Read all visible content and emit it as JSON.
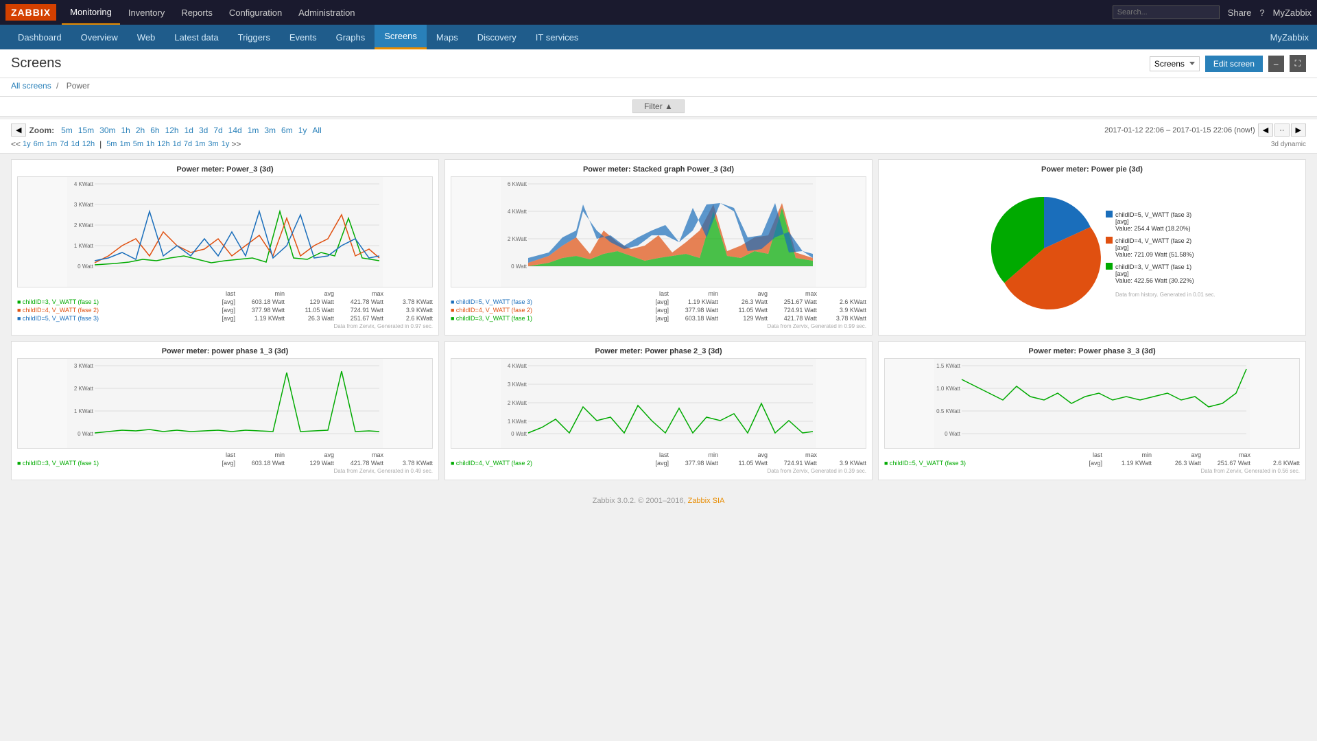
{
  "app": {
    "logo": "ZABBIX"
  },
  "top_nav": {
    "items": [
      {
        "label": "Monitoring",
        "active": true
      },
      {
        "label": "Inventory",
        "active": false
      },
      {
        "label": "Reports",
        "active": false
      },
      {
        "label": "Configuration",
        "active": false
      },
      {
        "label": "Administration",
        "active": false
      }
    ],
    "right": {
      "search_placeholder": "Search...",
      "share": "Share",
      "help": "?",
      "user": "MyZabbix"
    }
  },
  "sub_nav": {
    "items": [
      {
        "label": "Dashboard"
      },
      {
        "label": "Overview"
      },
      {
        "label": "Web"
      },
      {
        "label": "Latest data"
      },
      {
        "label": "Triggers"
      },
      {
        "label": "Events"
      },
      {
        "label": "Graphs"
      },
      {
        "label": "Screens",
        "active": true
      },
      {
        "label": "Maps"
      },
      {
        "label": "Discovery"
      },
      {
        "label": "IT services"
      }
    ],
    "right": "MyZabbix"
  },
  "page": {
    "title": "Screens",
    "breadcrumb_home": "All screens",
    "breadcrumb_separator": "/",
    "breadcrumb_current": "Power",
    "screens_dropdown": "Screens",
    "edit_button": "Edit screen",
    "filter_label": "Filter ▲"
  },
  "zoom": {
    "label": "Zoom:",
    "options": [
      "5m",
      "15m",
      "30m",
      "1h",
      "2h",
      "6h",
      "12h",
      "1d",
      "3d",
      "7d",
      "14d",
      "1m",
      "3m",
      "6m",
      "1y",
      "All"
    ],
    "date_range": "2017-01-12 22:06 – 2017-01-15 22:06 (now!)",
    "time_nav": [
      "<<",
      "1y",
      "6m",
      "1m",
      "7d",
      "1d",
      "12h",
      "5m",
      "1m",
      "5m",
      "1h",
      "12h",
      "1d",
      "7d",
      "1m",
      "3m",
      "1y",
      ">>"
    ],
    "period_label": "3d dynamic"
  },
  "charts": {
    "row1": [
      {
        "title": "Power meter: Power_3 (3d)",
        "y_labels": [
          "4 KWatt",
          "3 KWatt",
          "2 KWatt",
          "1 KWatt",
          "0 Watt"
        ],
        "series": [
          {
            "label": "childID=3, V_WATT (fase 1)",
            "color": "#00aa00",
            "last": "603.18 Watt",
            "min": "129 Watt",
            "avg": "421.78 Watt",
            "max": "3.78 KWatt"
          },
          {
            "label": "childID=4, V_WATT (fase 2)",
            "color": "#e05010",
            "last": "377.98 Watt",
            "min": "11.05 Watt",
            "avg": "724.91 Watt",
            "max": "3.9 KWatt"
          },
          {
            "label": "childID=5, V_WATT (fase 3)",
            "color": "#1a6ebb",
            "last": "1.19 KWatt",
            "min": "26.3 Watt",
            "avg": "251.67 Watt",
            "max": "2.6 KWatt"
          }
        ]
      },
      {
        "title": "Power meter: Stacked graph Power_3 (3d)",
        "y_labels": [
          "6 KWatt",
          "4 KWatt",
          "2 KWatt",
          "0 Watt"
        ],
        "series": [
          {
            "label": "childID=5, V_WATT (fase 3)",
            "color": "#1a6ebb",
            "last": "1.19 KWatt",
            "min": "26.3 Watt",
            "avg": "251.67 Watt",
            "max": "2.6 KWatt"
          },
          {
            "label": "childID=4, V_WATT (fase 2)",
            "color": "#e05010",
            "last": "377.98 Watt",
            "min": "11.05 Watt",
            "avg": "724.91 Watt",
            "max": "3.9 KWatt"
          },
          {
            "label": "childID=3, V_WATT (fase 1)",
            "color": "#00aa00",
            "last": "603.18 Watt",
            "min": "129 Watt",
            "avg": "421.78 Watt",
            "max": "3.78 KWatt"
          }
        ]
      },
      {
        "title": "Power meter: Power pie (3d)",
        "pie_slices": [
          {
            "label": "childID=5, V_WATT (fase 3)",
            "color": "#1a6ebb",
            "value": "254.4 Watt (18.20%)"
          },
          {
            "label": "childID=4, V_WATT (fase 2)",
            "color": "#e05010",
            "value": "721.09 Watt (51.58%)"
          },
          {
            "label": "childID=3, V_WATT (fase 1)",
            "color": "#00aa00",
            "value": "422.56 Watt (30.22%)"
          }
        ]
      }
    ],
    "row2": [
      {
        "title": "Power meter: power phase 1_3 (3d)",
        "y_labels": [
          "3 KWatt",
          "2 KWatt",
          "1 KWatt",
          "0 Watt"
        ],
        "series": [
          {
            "label": "childID=3, V_WATT (fase 1)",
            "color": "#00aa00",
            "last": "603.18 Watt",
            "min": "129 Watt",
            "avg": "421.78 Watt",
            "max": "3.78 KWatt"
          }
        ]
      },
      {
        "title": "Power meter: Power phase 2_3 (3d)",
        "y_labels": [
          "4 KWatt",
          "3 KWatt",
          "2 KWatt",
          "1 KWatt",
          "0 Watt"
        ],
        "series": [
          {
            "label": "childID=4, V_WATT (fase 2)",
            "color": "#00aa00",
            "last": "377.98 Watt",
            "min": "11.05 Watt",
            "avg": "724.91 Watt",
            "max": "3.9 KWatt"
          }
        ]
      },
      {
        "title": "Power meter: Power phase 3_3 (3d)",
        "y_labels": [
          "1.5 KWatt",
          "1.0 KWatt",
          "0.5 KWatt",
          "0 Watt"
        ],
        "series": [
          {
            "label": "childID=5, V_WATT (fase 3)",
            "color": "#00aa00",
            "last": "1.19 KWatt",
            "min": "26.3 Watt",
            "avg": "251.67 Watt",
            "max": "2.6 KWatt"
          }
        ]
      }
    ]
  },
  "footer": {
    "text": "Zabbix 3.0.2. © 2001–2016,",
    "link_text": "Zabbix SIA",
    "link_suffix": ""
  }
}
